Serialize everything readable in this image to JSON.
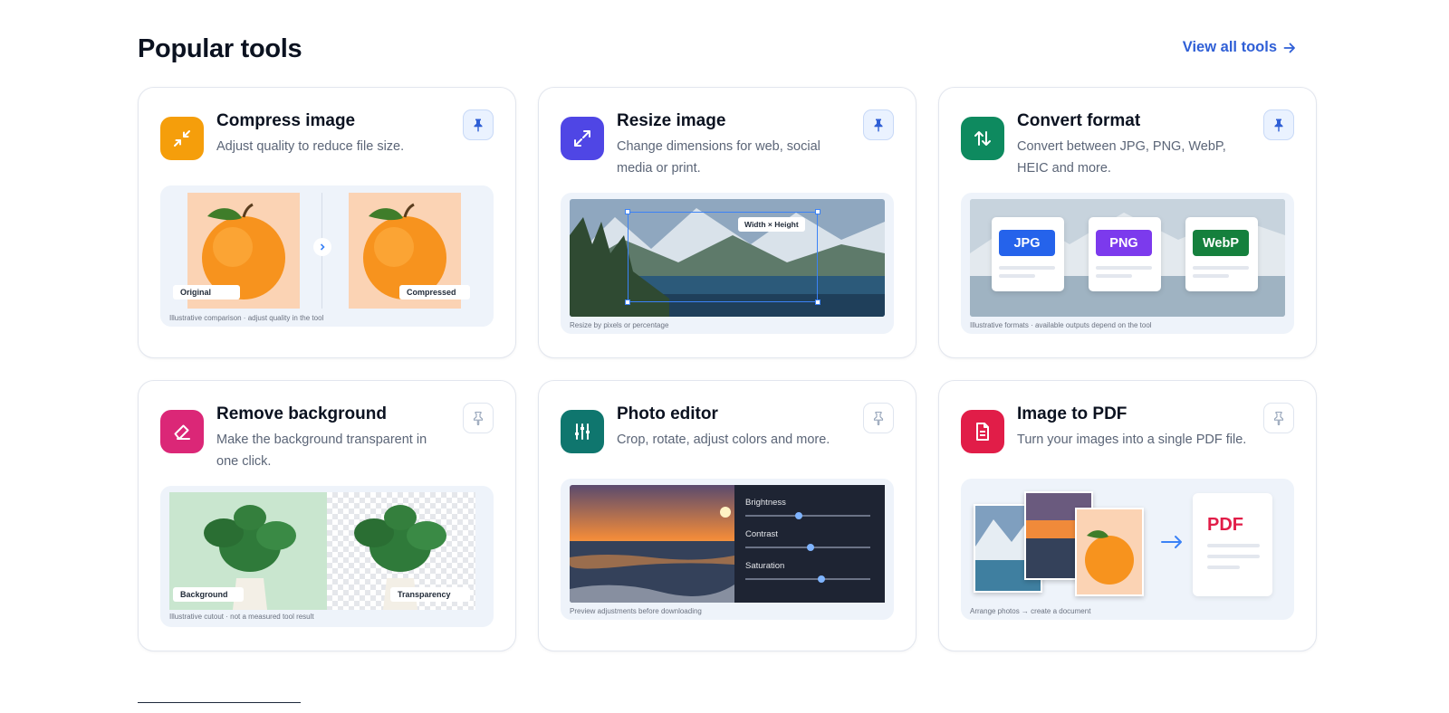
{
  "header": {
    "title": "Popular tools",
    "view_all": "View all tools"
  },
  "tools": [
    {
      "name": "Compress image",
      "description": "Adjust quality to reduce file size.",
      "pinned": true,
      "icon": "compress-arrows-icon",
      "icon_color": "#f59e0b",
      "preview": {
        "left_label": "Original",
        "right_label": "Compressed",
        "caption": "Illustrative comparison · adjust quality in the tool"
      }
    },
    {
      "name": "Resize image",
      "description": "Change dimensions for web, social media or print.",
      "pinned": true,
      "icon": "expand-arrows-icon",
      "icon_color": "#4f46e5",
      "preview": {
        "overlay_label": "Width × Height",
        "caption": "Resize by pixels or percentage"
      }
    },
    {
      "name": "Convert format",
      "description": "Convert between JPG, PNG, WebP, HEIC and more.",
      "pinned": true,
      "icon": "swap-arrows-icon",
      "icon_color": "#0e8a5f",
      "preview": {
        "formats": [
          "JPG",
          "PNG",
          "WebP"
        ],
        "format_colors": [
          "#2563eb",
          "#7c3aed",
          "#15803d"
        ],
        "caption": "Illustrative formats · available outputs depend on the tool"
      }
    },
    {
      "name": "Remove background",
      "description": "Make the background transparent in one click.",
      "pinned": false,
      "icon": "eraser-icon",
      "icon_color": "#db2777",
      "preview": {
        "left_label": "Background",
        "right_label": "Transparency",
        "caption": "Illustrative cutout · not a measured tool result"
      }
    },
    {
      "name": "Photo editor",
      "description": "Crop, rotate, adjust colors and more.",
      "pinned": false,
      "icon": "sliders-icon",
      "icon_color": "#0f766e",
      "preview": {
        "sliders": [
          {
            "label": "Brightness",
            "level": 0.43
          },
          {
            "label": "Contrast",
            "level": 0.52
          },
          {
            "label": "Saturation",
            "level": 0.61
          }
        ],
        "caption": "Preview adjustments before downloading"
      }
    },
    {
      "name": "Image to PDF",
      "description": "Turn your images into a single PDF file.",
      "pinned": false,
      "icon": "document-icon",
      "icon_color": "#e11d48",
      "preview": {
        "pdf_label": "PDF",
        "caption": "Arrange photos → create a document"
      }
    }
  ]
}
